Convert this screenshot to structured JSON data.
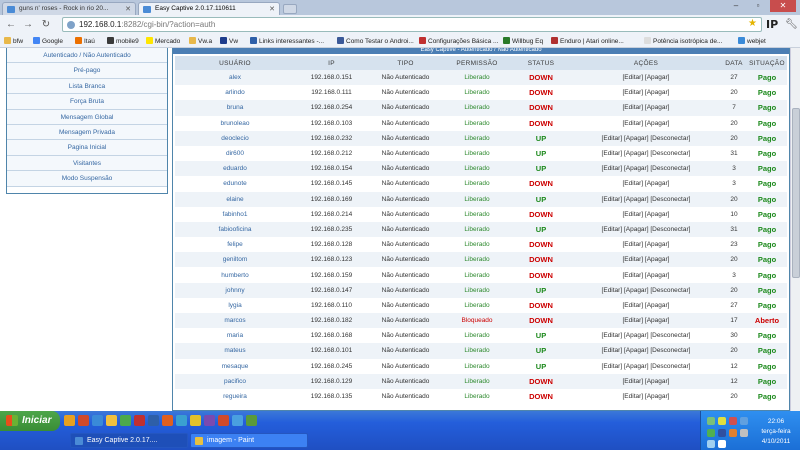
{
  "browser": {
    "tabs": [
      {
        "label": "guns n' roses - Rock in rio 20..."
      },
      {
        "label": "Easy Captive 2.0.17.110611"
      }
    ],
    "url_host": "192.168.0.1",
    "url_rest": ":8282/cgi-bin/?action=auth",
    "ip_icon_label": "IP",
    "bookmarks": [
      "bfw",
      "Google",
      "Itaú",
      "mobile9",
      "Mercado",
      "Vw.a",
      "Vw",
      "Links interessantes -...",
      "Como Testar o Androi...",
      "Configurações Básica ...",
      "Willbug Eq",
      "Enduro | Atari online...",
      "Potência isotrópica de...",
      "webjet"
    ]
  },
  "sidebar": {
    "items": [
      "Autenticado / Não Autenticado",
      "Pré-pago",
      "Lista Branca",
      "Força Bruta",
      "Mensagem Global",
      "Mensagem Privada",
      "Pagina Inicial",
      "Visitantes",
      "Modo Suspensão"
    ]
  },
  "table": {
    "title": "Easy Captive - Autenticado / Não Autenticado",
    "headers": [
      "USUÁRIO",
      "IP",
      "TIPO",
      "PERMISSÃO",
      "STATUS",
      "AÇÕES",
      "DATA",
      "SITUAÇÃO"
    ],
    "rows": [
      {
        "user": "alex",
        "ip": "192.168.0.151",
        "tipo": "Não Autenticado",
        "perm": "Liberado",
        "status": "DOWN",
        "acoes": "[Editar] [Apagar]",
        "data": "27",
        "sit": "Pago"
      },
      {
        "user": "arlindo",
        "ip": "192.168.0.111",
        "tipo": "Não Autenticado",
        "perm": "Liberado",
        "status": "DOWN",
        "acoes": "[Editar] [Apagar]",
        "data": "20",
        "sit": "Pago"
      },
      {
        "user": "bruna",
        "ip": "192.168.0.254",
        "tipo": "Não Autenticado",
        "perm": "Liberado",
        "status": "DOWN",
        "acoes": "[Editar] [Apagar]",
        "data": "7",
        "sit": "Pago"
      },
      {
        "user": "brunoleao",
        "ip": "192.168.0.103",
        "tipo": "Não Autenticado",
        "perm": "Liberado",
        "status": "DOWN",
        "acoes": "[Editar] [Apagar]",
        "data": "20",
        "sit": "Pago"
      },
      {
        "user": "deoclecio",
        "ip": "192.168.0.232",
        "tipo": "Não Autenticado",
        "perm": "Liberado",
        "status": "UP",
        "acoes": "[Editar] [Apagar] [Desconectar]",
        "data": "20",
        "sit": "Pago"
      },
      {
        "user": "dir600",
        "ip": "192.168.0.212",
        "tipo": "Não Autenticado",
        "perm": "Liberado",
        "status": "UP",
        "acoes": "[Editar] [Apagar] [Desconectar]",
        "data": "31",
        "sit": "Pago"
      },
      {
        "user": "eduardo",
        "ip": "192.168.0.154",
        "tipo": "Não Autenticado",
        "perm": "Liberado",
        "status": "UP",
        "acoes": "[Editar] [Apagar] [Desconectar]",
        "data": "3",
        "sit": "Pago"
      },
      {
        "user": "edunote",
        "ip": "192.168.0.145",
        "tipo": "Não Autenticado",
        "perm": "Liberado",
        "status": "DOWN",
        "acoes": "[Editar] [Apagar]",
        "data": "3",
        "sit": "Pago"
      },
      {
        "user": "elaine",
        "ip": "192.168.0.169",
        "tipo": "Não Autenticado",
        "perm": "Liberado",
        "status": "UP",
        "acoes": "[Editar] [Apagar] [Desconectar]",
        "data": "20",
        "sit": "Pago"
      },
      {
        "user": "fabinho1",
        "ip": "192.168.0.214",
        "tipo": "Não Autenticado",
        "perm": "Liberado",
        "status": "DOWN",
        "acoes": "[Editar] [Apagar]",
        "data": "10",
        "sit": "Pago"
      },
      {
        "user": "fabiooficina",
        "ip": "192.168.0.235",
        "tipo": "Não Autenticado",
        "perm": "Liberado",
        "status": "UP",
        "acoes": "[Editar] [Apagar] [Desconectar]",
        "data": "31",
        "sit": "Pago"
      },
      {
        "user": "felipe",
        "ip": "192.168.0.128",
        "tipo": "Não Autenticado",
        "perm": "Liberado",
        "status": "DOWN",
        "acoes": "[Editar] [Apagar]",
        "data": "23",
        "sit": "Pago"
      },
      {
        "user": "geniltom",
        "ip": "192.168.0.123",
        "tipo": "Não Autenticado",
        "perm": "Liberado",
        "status": "DOWN",
        "acoes": "[Editar] [Apagar]",
        "data": "20",
        "sit": "Pago"
      },
      {
        "user": "humberto",
        "ip": "192.168.0.159",
        "tipo": "Não Autenticado",
        "perm": "Liberado",
        "status": "DOWN",
        "acoes": "[Editar] [Apagar]",
        "data": "3",
        "sit": "Pago"
      },
      {
        "user": "johnny",
        "ip": "192.168.0.147",
        "tipo": "Não Autenticado",
        "perm": "Liberado",
        "status": "UP",
        "acoes": "[Editar] [Apagar] [Desconectar]",
        "data": "20",
        "sit": "Pago"
      },
      {
        "user": "lygia",
        "ip": "192.168.0.110",
        "tipo": "Não Autenticado",
        "perm": "Liberado",
        "status": "DOWN",
        "acoes": "[Editar] [Apagar]",
        "data": "27",
        "sit": "Pago"
      },
      {
        "user": "marcos",
        "ip": "192.168.0.182",
        "tipo": "Não Autenticado",
        "perm": "Bloqueado",
        "status": "DOWN",
        "acoes": "[Editar] [Apagar]",
        "data": "17",
        "sit": "Aberto"
      },
      {
        "user": "maria",
        "ip": "192.168.0.168",
        "tipo": "Não Autenticado",
        "perm": "Liberado",
        "status": "UP",
        "acoes": "[Editar] [Apagar] [Desconectar]",
        "data": "30",
        "sit": "Pago"
      },
      {
        "user": "mateus",
        "ip": "192.168.0.101",
        "tipo": "Não Autenticado",
        "perm": "Liberado",
        "status": "UP",
        "acoes": "[Editar] [Apagar] [Desconectar]",
        "data": "20",
        "sit": "Pago"
      },
      {
        "user": "mesaque",
        "ip": "192.168.0.245",
        "tipo": "Não Autenticado",
        "perm": "Liberado",
        "status": "UP",
        "acoes": "[Editar] [Apagar] [Desconectar]",
        "data": "12",
        "sit": "Pago"
      },
      {
        "user": "pacifico",
        "ip": "192.168.0.129",
        "tipo": "Não Autenticado",
        "perm": "Liberado",
        "status": "DOWN",
        "acoes": "[Editar] [Apagar]",
        "data": "12",
        "sit": "Pago"
      },
      {
        "user": "regueira",
        "ip": "192.168.0.135",
        "tipo": "Não Autenticado",
        "perm": "Liberado",
        "status": "DOWN",
        "acoes": "[Editar] [Apagar]",
        "data": "20",
        "sit": "Pago"
      }
    ]
  },
  "taskbar": {
    "start_label": "Iniciar",
    "tasks": [
      "Easy Captive 2.0.17....",
      "imagem - Paint"
    ],
    "clock_time": "22:06",
    "clock_day": "terça-feira",
    "clock_date": "4/10/2011"
  },
  "colors": {
    "accent": "#4b7eb4",
    "down": "#cc0000",
    "up": "#1d8a1d"
  }
}
